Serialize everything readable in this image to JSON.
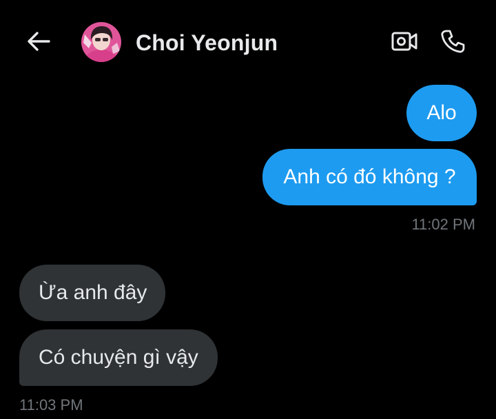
{
  "header": {
    "contact_name": "Choi Yeonjun",
    "back_icon": "arrow-left-icon",
    "video_icon": "video-camera-icon",
    "call_icon": "phone-icon"
  },
  "messages": [
    {
      "direction": "outgoing",
      "text": "Alo"
    },
    {
      "direction": "outgoing",
      "text": "Anh có đó không ?"
    },
    {
      "direction": "incoming",
      "text": "Ừa anh đây"
    },
    {
      "direction": "incoming",
      "text": "Có chuyện gì vậy"
    }
  ],
  "timestamps": {
    "outgoing_group": "11:02 PM",
    "incoming_group": "11:03 PM"
  },
  "colors": {
    "background": "#000000",
    "outgoing_bubble": "#1d9bf0",
    "incoming_bubble": "#2f3336",
    "timestamp": "#71767b",
    "text": "#e7e9ea"
  }
}
